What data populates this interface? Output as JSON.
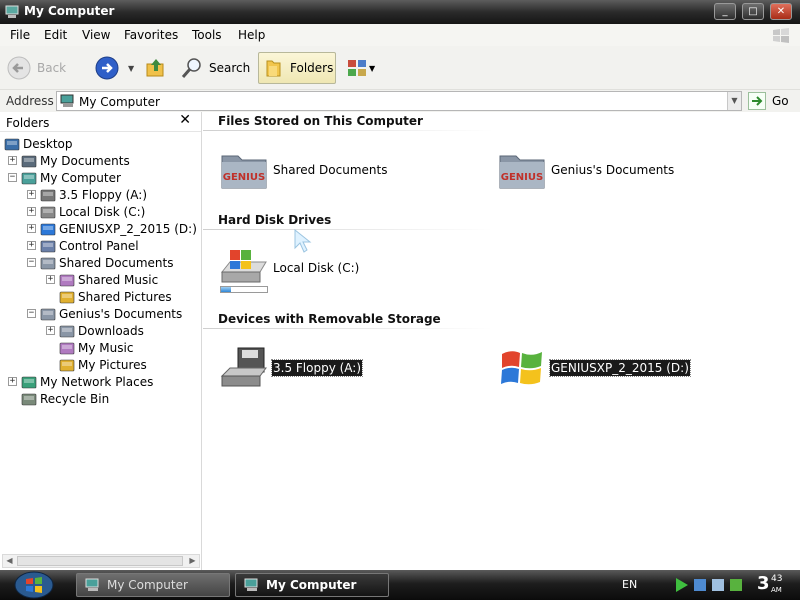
{
  "window": {
    "title": "My Computer",
    "controls": {
      "minimize": "_",
      "maximize": "□",
      "close": "✕"
    }
  },
  "menu": [
    "File",
    "Edit",
    "View",
    "Favorites",
    "Tools",
    "Help"
  ],
  "toolbar": {
    "back_label": "Back",
    "search_label": "Search",
    "folders_label": "Folders"
  },
  "address": {
    "label": "Address",
    "value": "My Computer",
    "go_label": "Go"
  },
  "folders_pane": {
    "title": "Folders",
    "close_glyph": "✕",
    "tree": [
      {
        "label": "Desktop",
        "icon": "desktop-icon",
        "expander": ""
      },
      {
        "label": "My Documents",
        "icon": "my-documents-icon",
        "expander": "+"
      },
      {
        "label": "My Computer",
        "icon": "my-computer-icon",
        "expander": "−"
      },
      {
        "label": "3.5 Floppy (A:)",
        "icon": "floppy-drive-icon",
        "expander": "+"
      },
      {
        "label": "Local Disk (C:)",
        "icon": "local-disk-icon",
        "expander": "+"
      },
      {
        "label": "GENIUSXP_2_2015 (D:)",
        "icon": "cd-drive-icon",
        "expander": "+"
      },
      {
        "label": "Control Panel",
        "icon": "control-panel-icon",
        "expander": "+"
      },
      {
        "label": "Shared Documents",
        "icon": "folder-icon",
        "expander": "−"
      },
      {
        "label": "Shared Music",
        "icon": "music-folder-icon",
        "expander": "+"
      },
      {
        "label": "Shared Pictures",
        "icon": "pictures-folder-icon",
        "expander": ""
      },
      {
        "label": "Genius's Documents",
        "icon": "folder-icon",
        "expander": "−"
      },
      {
        "label": "Downloads",
        "icon": "folder-icon",
        "expander": "+"
      },
      {
        "label": "My Music",
        "icon": "music-folder-icon",
        "expander": ""
      },
      {
        "label": "My Pictures",
        "icon": "pictures-folder-icon",
        "expander": ""
      },
      {
        "label": "My Network Places",
        "icon": "network-places-icon",
        "expander": "+"
      },
      {
        "label": "Recycle Bin",
        "icon": "recycle-bin-icon",
        "expander": ""
      }
    ]
  },
  "main": {
    "groups": [
      {
        "title": "Files Stored on This Computer"
      },
      {
        "title": "Hard Disk Drives"
      },
      {
        "title": "Devices with Removable Storage"
      }
    ],
    "items": [
      {
        "label": "Shared Documents",
        "folder_text": "GENIUS"
      },
      {
        "label": "Genius's Documents",
        "folder_text": "GENIUS"
      },
      {
        "label": "Local Disk (C:)",
        "used_fraction": 0.22
      },
      {
        "label": "3.5 Floppy (A:)"
      },
      {
        "label": "GENIUSXP_2_2015 (D:)"
      }
    ]
  },
  "taskbar": {
    "tasks": [
      {
        "label": "My Computer",
        "state": "inactive"
      },
      {
        "label": "My Computer",
        "state": "active"
      }
    ],
    "language": "EN",
    "clock": {
      "hour": "3",
      "minute": "43",
      "ampm": "AM"
    }
  },
  "colors": {
    "selection": "#1a1a1a",
    "folders_button_bg": "#f4eec4",
    "titlebar": "#2b2b2b"
  }
}
